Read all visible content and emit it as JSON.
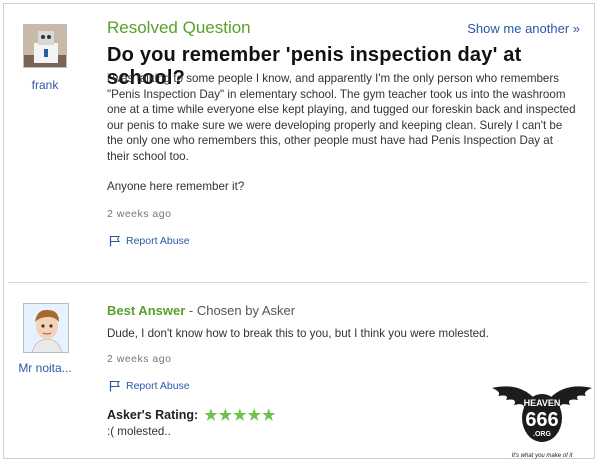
{
  "question": {
    "status_label": "Resolved Question",
    "show_another_label": "Show me another »",
    "asker_name": "frank",
    "title": "Do you remember 'penis inspection day' at school?",
    "body_paragraph_1": "i was talking to some people I know, and apparently I'm the only person who remembers \"Penis Inspection Day\" in elementary school. The gym teacher took us into the washroom one at a time while everyone else kept playing, and tugged our foreskin back and inspected our penis to make sure we were developing properly and keeping clean. Surely I can't be the only one who remembers this, other people must have had Penis Inspection Day at their school too.",
    "body_paragraph_2": "Anyone here remember it?",
    "timestamp": "2 weeks ago",
    "report_label": "Report Abuse"
  },
  "answer": {
    "label": "Best Answer",
    "chosen_by": " - Chosen by Asker",
    "answerer_name": "Mr noita...",
    "text": "Dude, I don't know how to break this to you, but I think you were molested.",
    "timestamp": "2 weeks ago",
    "report_label": "Report Abuse",
    "rating_label": "Asker's Rating:",
    "rating_stars": "★★★★★",
    "rating_value": 5,
    "rating_comment": ":( molested.."
  },
  "watermark": {
    "line1": "HEAVEN",
    "line2": "666",
    "line3": ".ORG",
    "tagline": "It's what you make of it"
  },
  "colors": {
    "accent_green": "#5aa02c",
    "link_blue": "#2a58a8",
    "star_green": "#6cc24a"
  }
}
